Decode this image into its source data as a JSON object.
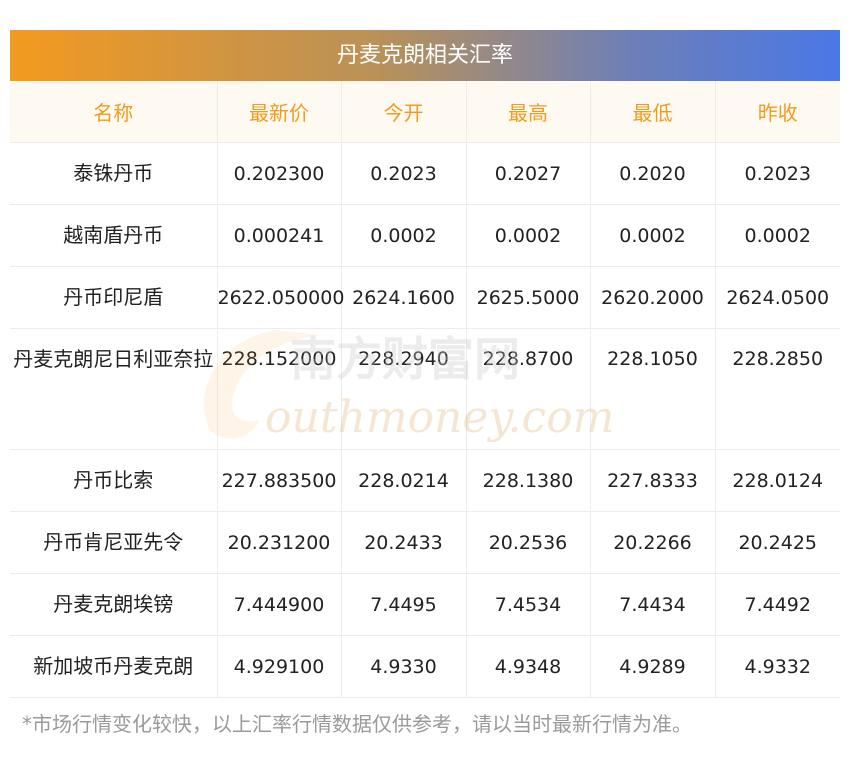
{
  "title": "丹麦克朗相关汇率",
  "columns": [
    "名称",
    "最新价",
    "今开",
    "最高",
    "最低",
    "昨收"
  ],
  "rows": [
    {
      "name": "泰铢丹币",
      "latest": "0.202300",
      "open": "0.2023",
      "high": "0.2027",
      "low": "0.2020",
      "prev": "0.2023"
    },
    {
      "name": "越南盾丹币",
      "latest": "0.000241",
      "open": "0.0002",
      "high": "0.0002",
      "low": "0.0002",
      "prev": "0.0002"
    },
    {
      "name": "丹币印尼盾",
      "latest": "2622.050000",
      "open": "2624.1600",
      "high": "2625.5000",
      "low": "2620.2000",
      "prev": "2624.0500"
    },
    {
      "name": "丹麦克朗尼日利亚奈拉",
      "latest": "228.152000",
      "open": "228.2940",
      "high": "228.8700",
      "low": "228.1050",
      "prev": "228.2850"
    },
    {
      "name": "丹币比索",
      "latest": "227.883500",
      "open": "228.0214",
      "high": "228.1380",
      "low": "227.8333",
      "prev": "228.0124"
    },
    {
      "name": "丹币肯尼亚先令",
      "latest": "20.231200",
      "open": "20.2433",
      "high": "20.2536",
      "low": "20.2266",
      "prev": "20.2425"
    },
    {
      "name": "丹麦克朗埃镑",
      "latest": "7.444900",
      "open": "7.4495",
      "high": "7.4534",
      "low": "7.4434",
      "prev": "7.4492"
    },
    {
      "name": "新加坡币丹麦克朗",
      "latest": "4.929100",
      "open": "4.9330",
      "high": "4.9348",
      "low": "4.9289",
      "prev": "4.9332"
    }
  ],
  "note": "*市场行情变化较快，以上汇率行情数据仅供参考，请以当时最新行情为准。",
  "watermark": {
    "cn": "南方财富网",
    "en": "outhmoney.com"
  },
  "colors": {
    "header_text": "#f39a1f",
    "header_bg": "#fffaf1",
    "banner_start": "#f39a1f",
    "banner_end": "#4a78e6"
  }
}
